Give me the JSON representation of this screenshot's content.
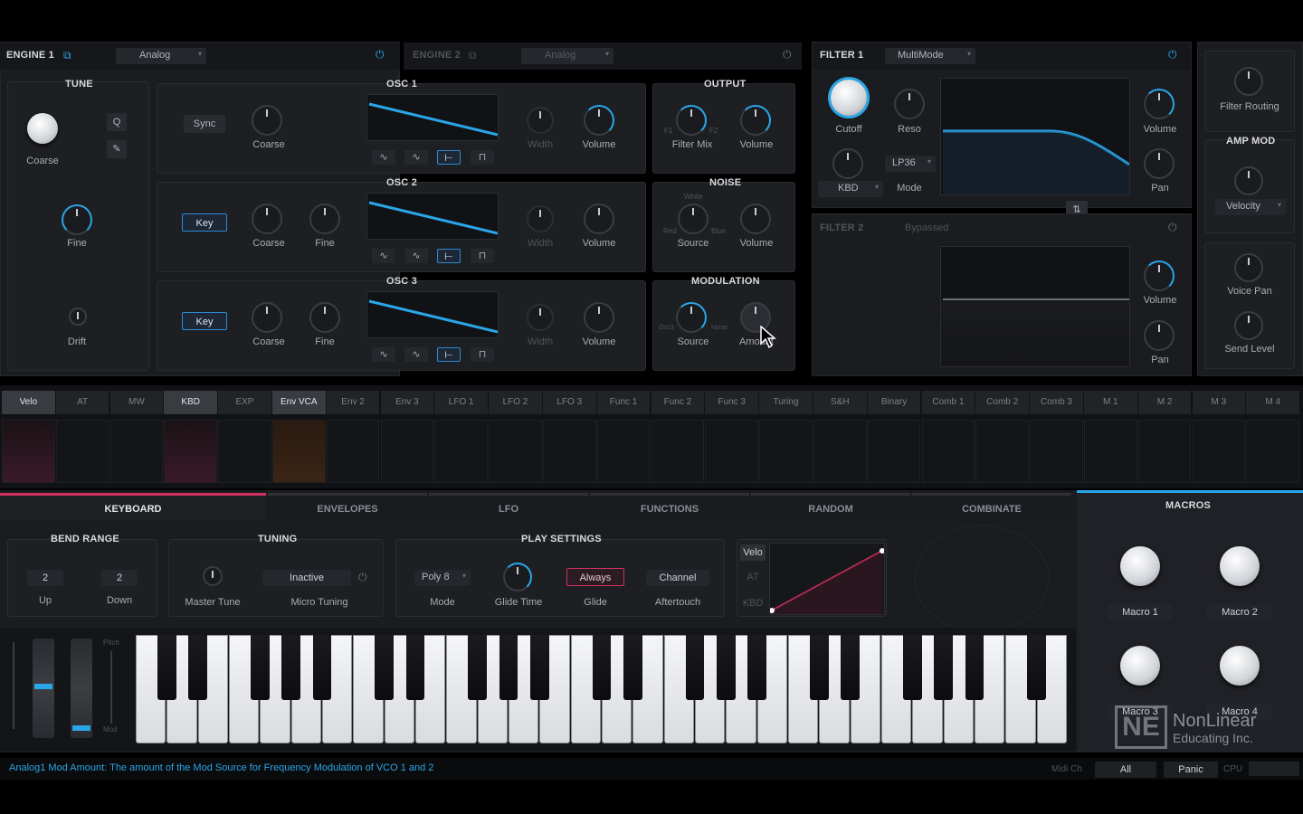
{
  "engine1": {
    "title": "ENGINE 1",
    "type": "Analog"
  },
  "engine2": {
    "title": "ENGINE 2",
    "type": "Analog"
  },
  "tune": {
    "title": "TUNE",
    "coarse": "Coarse",
    "fine": "Fine",
    "drift": "Drift",
    "q_label": "Q"
  },
  "osc1": {
    "title": "OSC 1",
    "sync": "Sync",
    "coarse": "Coarse",
    "width": "Width",
    "volume": "Volume"
  },
  "osc2": {
    "title": "OSC 2",
    "key": "Key",
    "coarse": "Coarse",
    "fine": "Fine",
    "width": "Width",
    "volume": "Volume"
  },
  "osc3": {
    "title": "OSC 3",
    "key": "Key",
    "coarse": "Coarse",
    "fine": "Fine",
    "width": "Width",
    "volume": "Volume"
  },
  "wave_buttons": [
    "∿",
    "∿",
    "⊢",
    "⊓"
  ],
  "output": {
    "title": "OUTPUT",
    "filter_mix": "Filter Mix",
    "volume": "Volume",
    "f1": "F1",
    "f2": "F2"
  },
  "noise": {
    "title": "NOISE",
    "source": "Source",
    "volume": "Volume",
    "white": "White",
    "red": "Red",
    "blue": "Blue"
  },
  "modulation": {
    "title": "MODULATION",
    "source": "Source",
    "amount": "Amount",
    "left": "Osc3",
    "right": "Noise"
  },
  "filter1": {
    "title": "FILTER 1",
    "mode_value": "MultiMode",
    "cutoff": "Cutoff",
    "reso": "Reso",
    "kbd": "KBD",
    "slope": "LP36",
    "mode": "Mode",
    "volume": "Volume",
    "pan": "Pan"
  },
  "filter2": {
    "title": "FILTER 2",
    "status": "Bypassed",
    "volume": "Volume",
    "pan": "Pan"
  },
  "right_col": {
    "filter_routing": "Filter Routing",
    "amp_mod_title": "AMP MOD",
    "velocity": "Velocity",
    "voice_pan": "Voice Pan",
    "send_level": "Send Level"
  },
  "mod_tabs": [
    "Velo",
    "AT",
    "MW",
    "KBD",
    "EXP",
    "Env VCA",
    "Env 2",
    "Env 3",
    "LFO 1",
    "LFO 2",
    "LFO 3",
    "Func 1",
    "Func 2",
    "Func 3",
    "Turing",
    "S&H",
    "Binary",
    "Comb 1",
    "Comb 2",
    "Comb 3",
    "M 1",
    "M 2",
    "M 3",
    "M 4"
  ],
  "bottom_tabs": [
    "KEYBOARD",
    "ENVELOPES",
    "LFO",
    "FUNCTIONS",
    "RANDOM",
    "COMBINATE"
  ],
  "macros": {
    "title": "MACROS",
    "m1": "Macro 1",
    "m2": "Macro 2",
    "m3": "Macro 3",
    "m4": "Macro 4"
  },
  "bend": {
    "title": "BEND RANGE",
    "up_val": "2",
    "down_val": "2",
    "up": "Up",
    "down": "Down"
  },
  "tuning": {
    "title": "TUNING",
    "master": "Master Tune",
    "micro_val": "Inactive",
    "micro": "Micro Tuning"
  },
  "play": {
    "title": "PLAY SETTINGS",
    "mode_val": "Poly 8",
    "mode": "Mode",
    "glide_time": "Glide Time",
    "glide_val": "Always",
    "glide": "Glide",
    "at_val": "Channel",
    "aftertouch": "Aftertouch"
  },
  "curve": {
    "velo": "Velo",
    "at": "AT",
    "kbd": "KBD"
  },
  "wheels": {
    "pitch": "Pitch",
    "mod": "Mod"
  },
  "status": {
    "text": "Analog1 Mod Amount: The amount of the Mod Source for Frequency Modulation of VCO 1 and 2",
    "midi_ch": "Midi Ch",
    "midi_val": "All",
    "preset": "Panic",
    "cpu": "CPU"
  },
  "watermark": {
    "logo": "NE",
    "line1": "NonLinear",
    "line2": "Educating Inc."
  },
  "colors": {
    "accent": "#2aa6e8",
    "pink": "#d2315f",
    "bg": "#1b1c20"
  }
}
